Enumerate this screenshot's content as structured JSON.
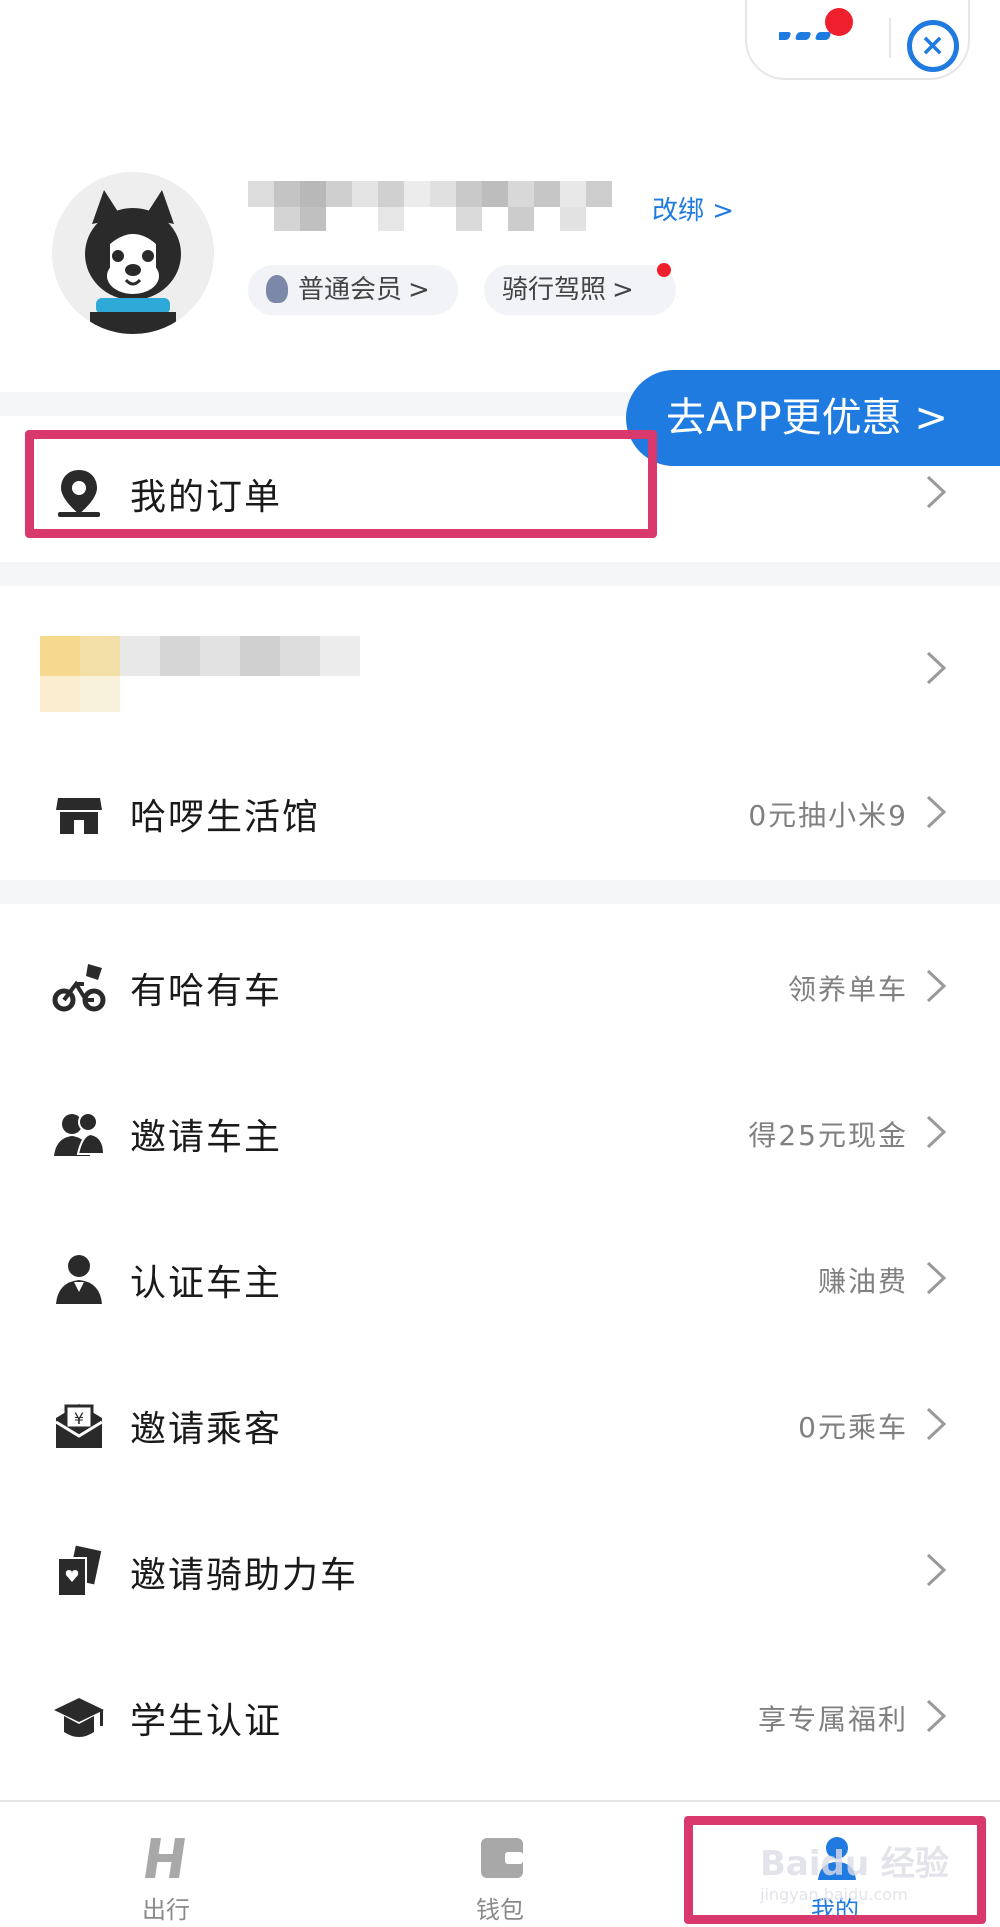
{
  "header": {
    "rebind_label": "改绑 >",
    "member_chip": "普通会员",
    "license_chip": "骑行驾照",
    "chip_arrow": ">"
  },
  "promo": {
    "label": "去APP更优惠 >"
  },
  "menu": {
    "orders": {
      "label": "我的订单"
    },
    "store": {
      "label": "哈啰生活馆",
      "sub": "0元抽小米9"
    },
    "bike": {
      "label": "有哈有车",
      "sub": "领养单车"
    },
    "invite_owner": {
      "label": "邀请车主",
      "sub": "得25元现金"
    },
    "verify_owner": {
      "label": "认证车主",
      "sub": "赚油费"
    },
    "invite_passenger": {
      "label": "邀请乘客",
      "sub": "0元乘车"
    },
    "invite_ride": {
      "label": "邀请骑助力车",
      "sub": ""
    },
    "student": {
      "label": "学生认证",
      "sub": "享专属福利"
    }
  },
  "tabbar": {
    "trip": "出行",
    "wallet": "钱包",
    "mine": "我的"
  },
  "watermark": {
    "brand": "Baidu 经验",
    "url": "jingyan.baidu.com"
  },
  "colors": {
    "accent": "#1f7be0",
    "highlight": "#d8386b",
    "badge": "#ef1f2d"
  }
}
